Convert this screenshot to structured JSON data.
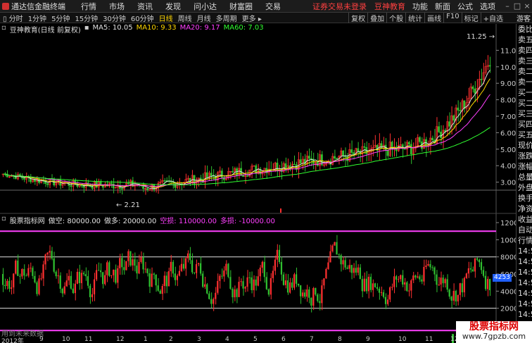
{
  "app": {
    "title": "通达信金融终端",
    "menus": [
      "行情",
      "市场",
      "资讯",
      "发现",
      "问小达",
      "财富圈",
      "交易"
    ],
    "alert": "证券交易未登录",
    "brand": "豆神教育",
    "right_menus": [
      "功能",
      "新面",
      "公式",
      "选项"
    ],
    "guest": "游客"
  },
  "tabs": [
    "分时",
    "1分钟",
    "5分钟",
    "15分钟",
    "30分钟",
    "60分钟",
    "日线",
    "周线",
    "月线",
    "多周期",
    "更多"
  ],
  "active_tab": "日线",
  "tools": [
    "复权",
    "叠加",
    "个股",
    "统计",
    "画线",
    "F10",
    "标记",
    "+自选"
  ],
  "main_chart": {
    "stock_label": "豆神教育(日线 前复权)",
    "ma": [
      {
        "label": "MA5: 10.05",
        "color": "#e0e0e0"
      },
      {
        "label": "MA10: 9.33",
        "color": "#ffd700"
      },
      {
        "label": "MA20: 9.17",
        "color": "#ff40ff"
      },
      {
        "label": "MA60: 7.03",
        "color": "#30ff30"
      }
    ],
    "high_label": "11.25",
    "low_label": "2.21",
    "y_ticks": [
      "11.00",
      "10.00",
      "9.00",
      "8.00",
      "7.00",
      "6.00",
      "5.00",
      "4.00",
      "3.00"
    ]
  },
  "indicator": {
    "title": "股票指标网",
    "labels": [
      {
        "label": "做空: 80000.00",
        "color": "#e0e0e0"
      },
      {
        "label": "做多: 20000.00",
        "color": "#e0e0e0"
      },
      {
        "label": "空损: 110000.00",
        "color": "#ff40ff"
      },
      {
        "label": "多损: -10000.00",
        "color": "#ff40ff"
      }
    ],
    "y_ticks": [
      "12000",
      "10000",
      "8000",
      "6000",
      "4000",
      "2000"
    ],
    "current_value": "4253",
    "no_data_text": "用到未来数据"
  },
  "x_axis": [
    "2012年",
    "9",
    "10",
    "11",
    "12",
    "1",
    "2",
    "3",
    "4",
    "5",
    "6",
    "7",
    "8",
    "9",
    "10",
    "11",
    "12"
  ],
  "right_panel": [
    "委比",
    "卖五",
    "卖四",
    "卖三",
    "卖二",
    "卖一",
    "买一",
    "买二",
    "买三",
    "买四",
    "买五",
    "现价",
    "涨跌",
    "涨幅",
    "总量",
    "外盘",
    "换手",
    "净资",
    "收益",
    "自动",
    "行情",
    "14:5",
    "14:5",
    "14:5",
    "14:5",
    "14:5",
    "14:5",
    "14:5",
    "14:5",
    "14:5"
  ],
  "watermark": {
    "title": "股票指标网",
    "url": "www.7gpzb.com"
  },
  "colors": {
    "up": "#ff3030",
    "down": "#30c030",
    "ma60": "#30ff30",
    "ma20": "#ff40ff",
    "ma10": "#ffd700",
    "ma5": "#e0e0e0"
  }
}
